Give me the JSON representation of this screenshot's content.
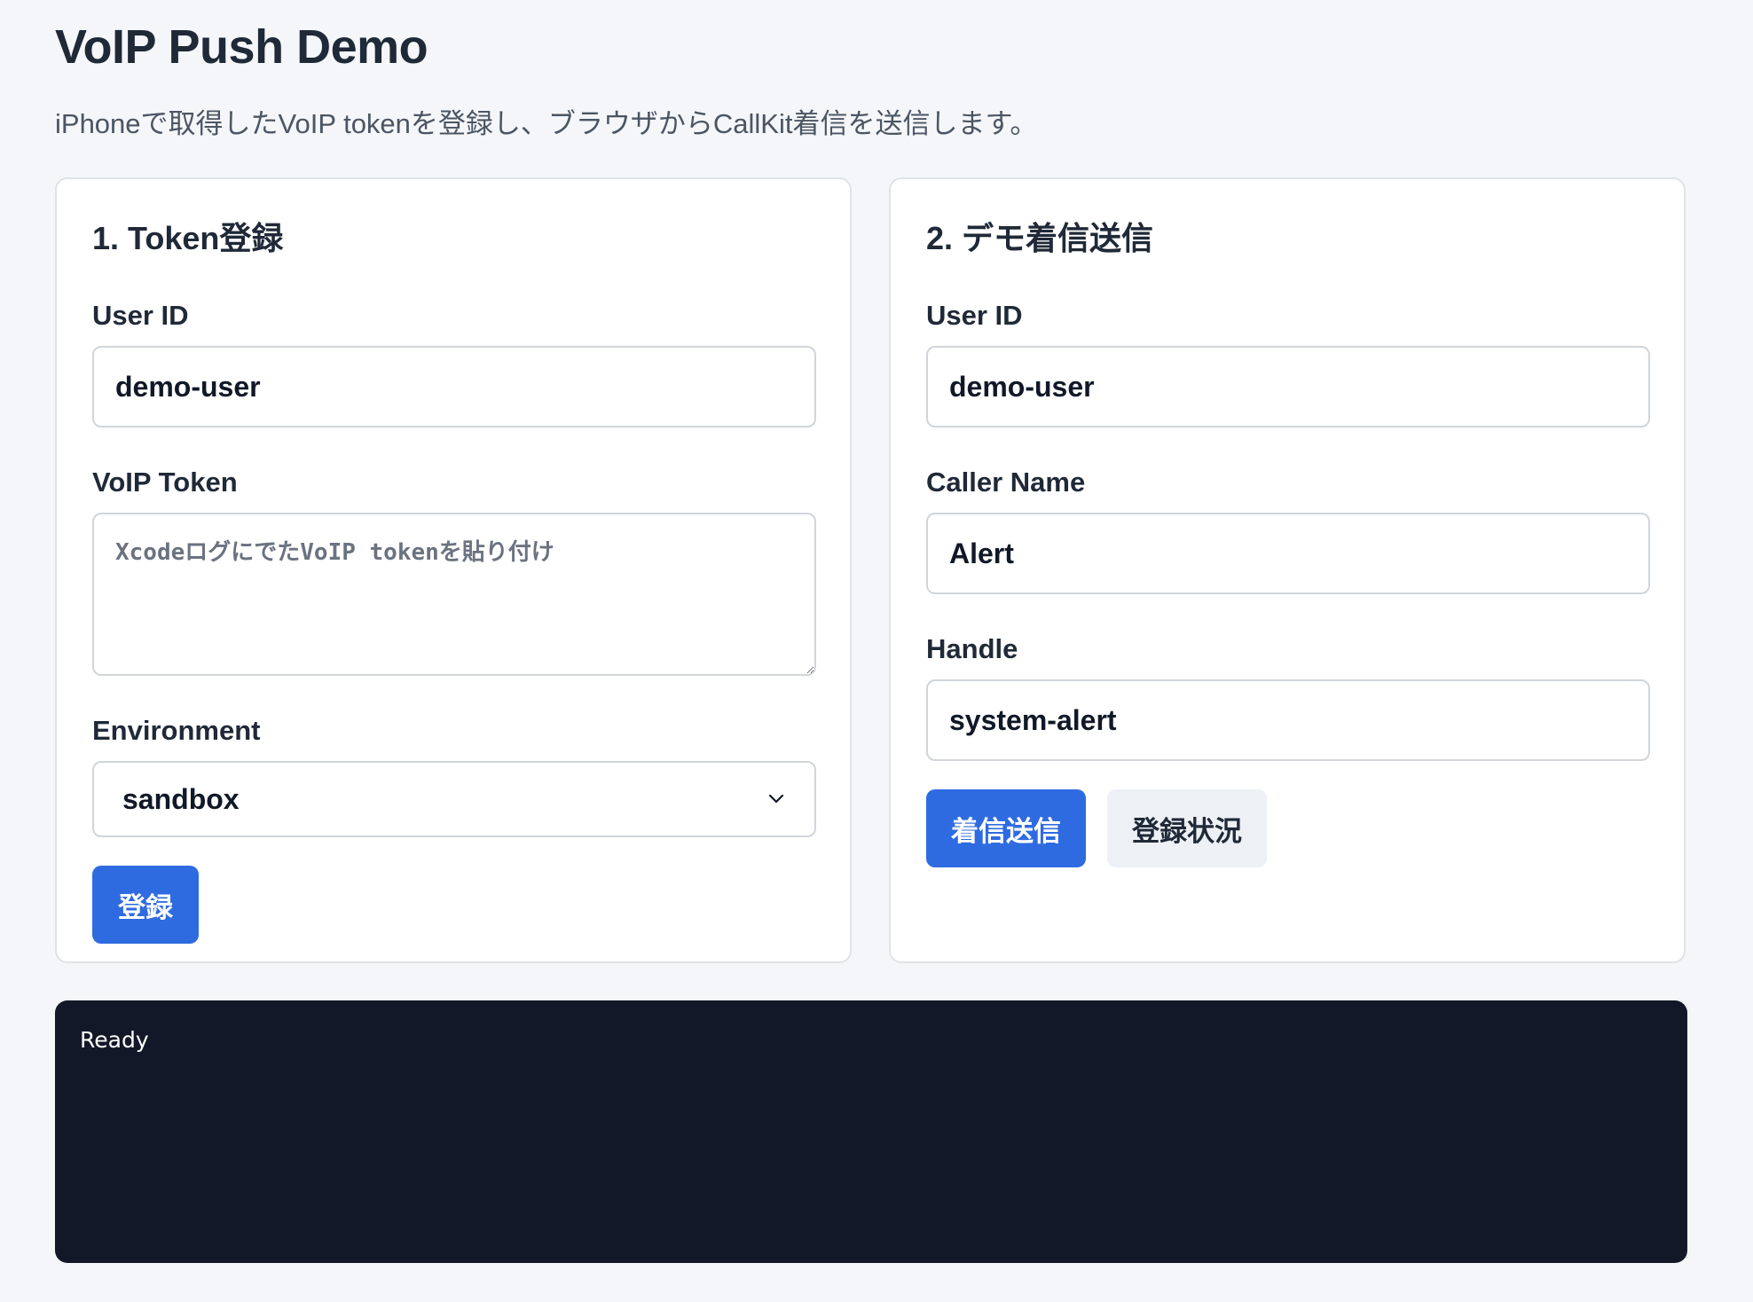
{
  "header": {
    "title": "VoIP Push Demo",
    "subtitle": "iPhoneで取得したVoIP tokenを登録し、ブラウザからCallKit着信を送信します。"
  },
  "register_card": {
    "title": "1. Token登録",
    "user_id_label": "User ID",
    "user_id_value": "demo-user",
    "token_label": "VoIP Token",
    "token_value": "",
    "token_placeholder": "XcodeログにでたVoIP tokenを貼り付け",
    "environment_label": "Environment",
    "environment_value": "sandbox",
    "register_button": "登録"
  },
  "call_card": {
    "title": "2. デモ着信送信",
    "user_id_label": "User ID",
    "user_id_value": "demo-user",
    "caller_name_label": "Caller Name",
    "caller_name_value": "Alert",
    "handle_label": "Handle",
    "handle_value": "system-alert",
    "send_button": "着信送信",
    "status_button": "登録状況"
  },
  "log": {
    "text": "Ready"
  },
  "icons": {
    "select_chevron": "chevron-down-icon"
  },
  "colors": {
    "primary": "#2f6be0",
    "log_background": "#121828",
    "page_background": "#f4f6f9"
  }
}
